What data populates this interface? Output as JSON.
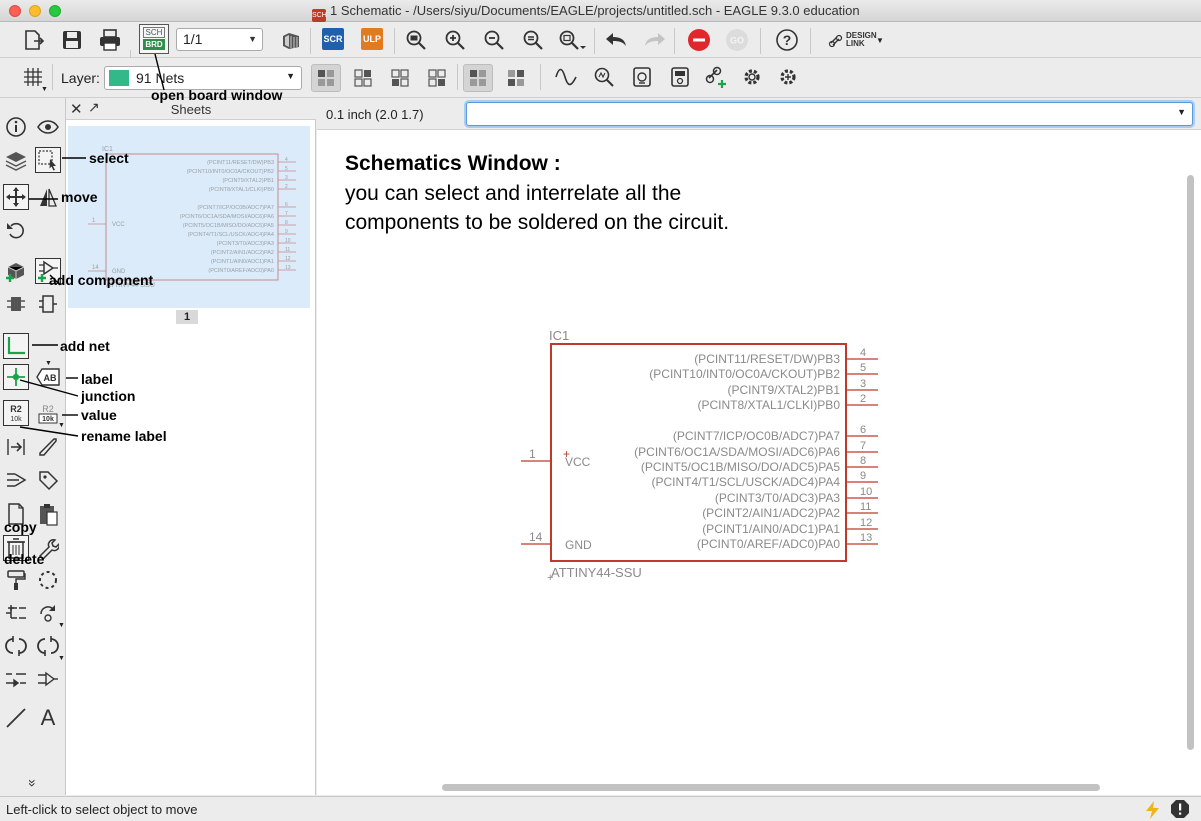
{
  "window": {
    "title": "1 Schematic - /Users/siyu/Documents/EAGLE/projects/untitled.sch - EAGLE 9.3.0 education",
    "title_icon": "SCH"
  },
  "toolbar": {
    "sheet_value": "1/1",
    "schbrd_top": "SCH",
    "schbrd_bottom": "BRD",
    "scr_label": "SCR",
    "ulp_label": "ULP",
    "help_label": "?",
    "design_link_top": "DESIGN",
    "design_link_bottom": "LINK",
    "layer_label": "Layer:",
    "layer_value": "91 Nets",
    "layer_color": "#33b889"
  },
  "sheets_panel": {
    "title": "Sheets",
    "sheet_number": "1"
  },
  "coord_bar": {
    "coordinates": "0.1 inch (2.0 1.7)",
    "command_value": ""
  },
  "description": {
    "title": "Schematics Window :",
    "body": "you can select and interrelate all the components to be soldered on the circuit."
  },
  "chip": {
    "name": "IC1",
    "value": "ATTINY44-SSU",
    "outline_color": "#c0392b",
    "left_pins": [
      {
        "num": "1",
        "label": "VCC"
      },
      {
        "num": "14",
        "label": "GND"
      }
    ],
    "right_pins": [
      {
        "num": "4",
        "label": "(PCINT11/RESET/DW)PB3"
      },
      {
        "num": "5",
        "label": "(PCINT10/INT0/OC0A/CKOUT)PB2"
      },
      {
        "num": "3",
        "label": "(PCINT9/XTAL2)PB1"
      },
      {
        "num": "2",
        "label": "(PCINT8/XTAL1/CLKI)PB0"
      },
      {
        "num": "6",
        "label": "(PCINT7/ICP/OC0B/ADC7)PA7"
      },
      {
        "num": "7",
        "label": "(PCINT6/OC1A/SDA/MOSI/ADC6)PA6"
      },
      {
        "num": "8",
        "label": "(PCINT5/OC1B/MISO/DO/ADC5)PA5"
      },
      {
        "num": "9",
        "label": "(PCINT4/T1/SCL/USCK/ADC4)PA4"
      },
      {
        "num": "10",
        "label": "(PCINT3/T0/ADC3)PA3"
      },
      {
        "num": "11",
        "label": "(PCINT2/AIN1/ADC2)PA2"
      },
      {
        "num": "12",
        "label": "(PCINT1/AIN0/ADC1)PA1"
      },
      {
        "num": "13",
        "label": "(PCINT0/AREF/ADC0)PA0"
      }
    ]
  },
  "annotations": {
    "open_board": "open board window",
    "select": "select",
    "move": "move",
    "add_component": "add component",
    "add_net": "add net",
    "label": "label",
    "junction": "junction",
    "value": "value",
    "rename_label": "rename label",
    "copy": "copy",
    "delete": "delete"
  },
  "tools": {
    "value_r2": "R2",
    "value_10k": "10k",
    "label_ab": "AB",
    "text_tool": "A",
    "more": "»"
  },
  "status": {
    "text": "Left-click to select object to move"
  }
}
